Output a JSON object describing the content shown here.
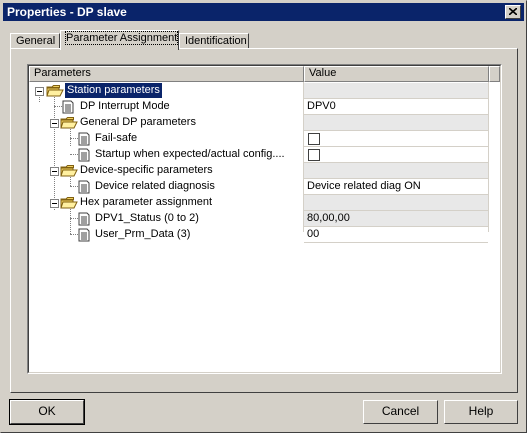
{
  "window": {
    "title": "Properties - DP slave",
    "close_glyph": "×"
  },
  "tabs": [
    {
      "label": "General"
    },
    {
      "label": "Parameter Assignment",
      "active": true
    },
    {
      "label": "Identification"
    }
  ],
  "grid": {
    "columns": {
      "name": "Parameters",
      "value": "Value"
    },
    "rows": [
      {
        "label": "Station parameters",
        "icon": "folder-open-icon",
        "expandable": true,
        "selected": true,
        "value": ""
      },
      {
        "label": "DP Interrupt Mode",
        "icon": "parameter-doc-icon",
        "value": "DPV0"
      },
      {
        "label": "General DP parameters",
        "icon": "folder-open-icon",
        "expandable": true,
        "value": ""
      },
      {
        "label": "Fail-safe",
        "icon": "parameter-doc-icon",
        "value": "",
        "checkbox": true,
        "checked": false
      },
      {
        "label": "Startup when expected/actual config....",
        "icon": "parameter-doc-icon",
        "value": "",
        "checkbox": true,
        "checked": false
      },
      {
        "label": "Device-specific parameters",
        "icon": "folder-open-icon",
        "expandable": true,
        "value": ""
      },
      {
        "label": "Device related diagnosis",
        "icon": "parameter-doc-icon",
        "value": "Device related diag ON"
      },
      {
        "label": "Hex parameter assignment",
        "icon": "folder-open-icon",
        "expandable": true,
        "value": ""
      },
      {
        "label": "DPV1_Status (0 to 2)",
        "icon": "parameter-doc-icon",
        "value": "80,00,00"
      },
      {
        "label": "User_Prm_Data (3)",
        "icon": "parameter-doc-icon",
        "value": "00"
      }
    ]
  },
  "buttons": {
    "ok": "OK",
    "cancel": "Cancel",
    "help": "Help"
  },
  "colors": {
    "titlebar": "#0a246a",
    "face": "#d4d0c8",
    "selection": "#0a246a",
    "folder": "#f0d060"
  }
}
